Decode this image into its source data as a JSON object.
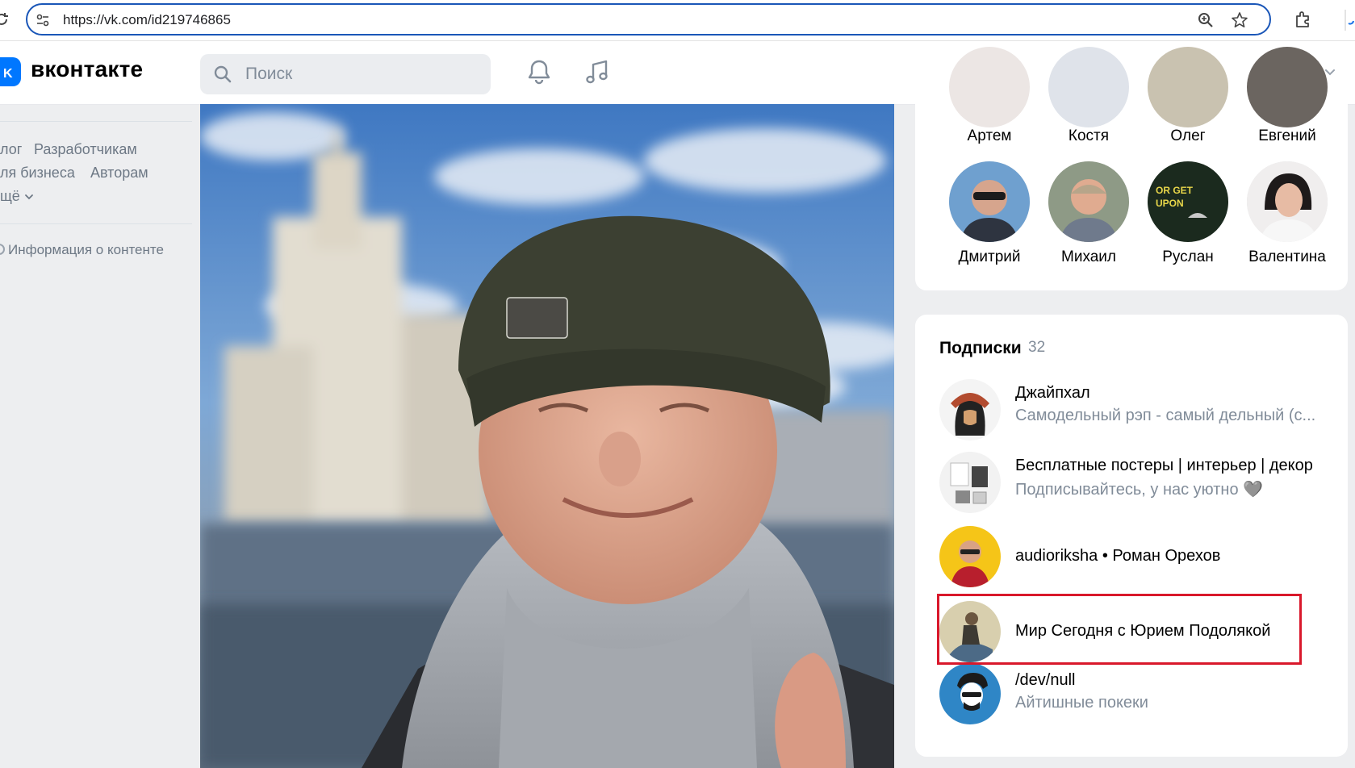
{
  "browser": {
    "url": "https://vk.com/id219746865"
  },
  "header": {
    "logo_text": "вконтакте",
    "search_placeholder": "Поиск"
  },
  "sidebar": {
    "links": [
      {
        "label": "лог"
      },
      {
        "label": "Разработчикам"
      },
      {
        "label": "ля бизнеса"
      },
      {
        "label": "Авторам"
      },
      {
        "label": "щё"
      },
      {
        "label": "Информация о контенте"
      }
    ]
  },
  "friends": {
    "top_row": [
      "Артем",
      "Костя",
      "Олег",
      "Евгений"
    ],
    "bottom_row": [
      "Дмитрий",
      "Михаил",
      "Руслан",
      "Валентина"
    ]
  },
  "subscriptions": {
    "title": "Подписки",
    "count": "32",
    "items": [
      {
        "name": "Джайпхал",
        "desc": "Самодельный рэп - самый дельный (с..."
      },
      {
        "name": "Бесплатные постеры | интерьер | декор",
        "desc": "Подписывайтесь, у нас уютно 🩶"
      },
      {
        "name": "audioriksha • Роман Орехов",
        "desc": ""
      },
      {
        "name": "Мир Сегодня с Юрием Подолякой",
        "desc": ""
      },
      {
        "name": "/dev/null",
        "desc": "Айтишные покеки"
      }
    ]
  },
  "colors": {
    "accent": "#0077ff",
    "highlight": "#d9182b",
    "secondary_text": "#818c99"
  }
}
